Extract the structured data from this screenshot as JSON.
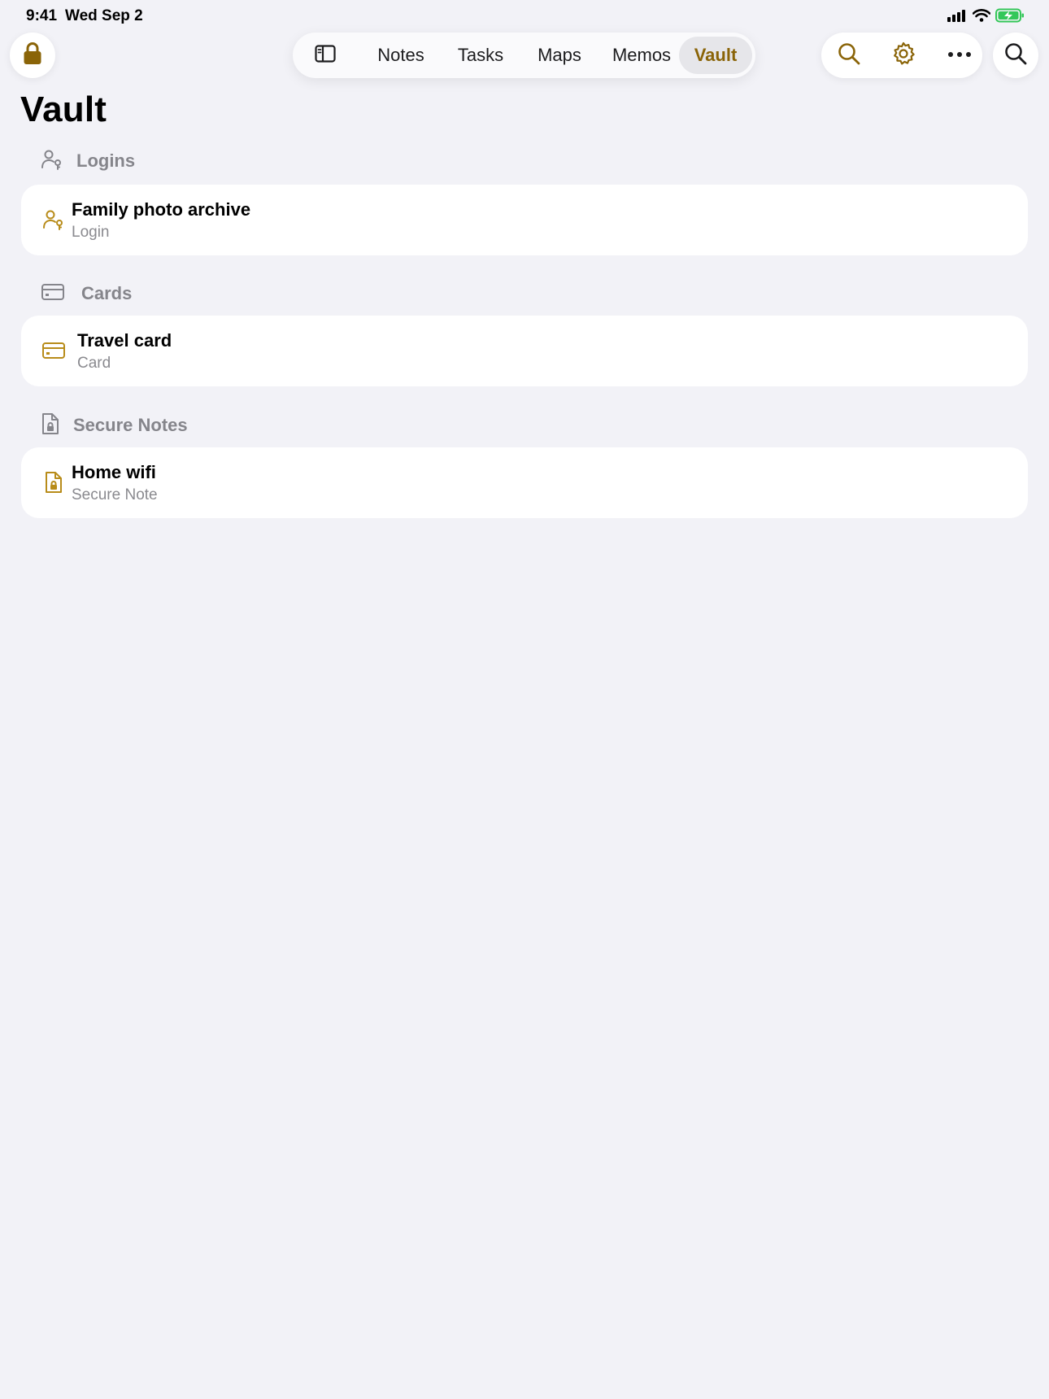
{
  "status_bar": {
    "time": "9:41",
    "date": "Wed Sep 2"
  },
  "top_bar": {
    "lock_icon": "lock-icon",
    "sidebar_icon": "sidebar-icon",
    "tabs": [
      {
        "label": "Notes",
        "active": false
      },
      {
        "label": "Tasks",
        "active": false
      },
      {
        "label": "Maps",
        "active": false
      },
      {
        "label": "Memos",
        "active": false
      },
      {
        "label": "Vault",
        "active": true
      }
    ],
    "tools": [
      "search-icon",
      "gear-icon",
      "more-icon"
    ],
    "right_search_icon": "search-icon"
  },
  "page": {
    "title": "Vault"
  },
  "sections": [
    {
      "label": "Logins",
      "icon": "person-key-icon",
      "items": [
        {
          "title": "Family photo archive",
          "subtitle": "Login"
        }
      ]
    },
    {
      "label": "Cards",
      "icon": "credit-card-icon",
      "items": [
        {
          "title": "Travel card",
          "subtitle": "Card"
        }
      ]
    },
    {
      "label": "Secure Notes",
      "icon": "locked-document-icon",
      "items": [
        {
          "title": "Home wifi",
          "subtitle": "Secure Note"
        }
      ]
    }
  ],
  "colors": {
    "accent": "#8a6408",
    "accent_light": "#b88c1a",
    "background": "#f2f2f7",
    "secondary_text": "#85858b",
    "active_tab_bg": "#e6e6ea"
  }
}
